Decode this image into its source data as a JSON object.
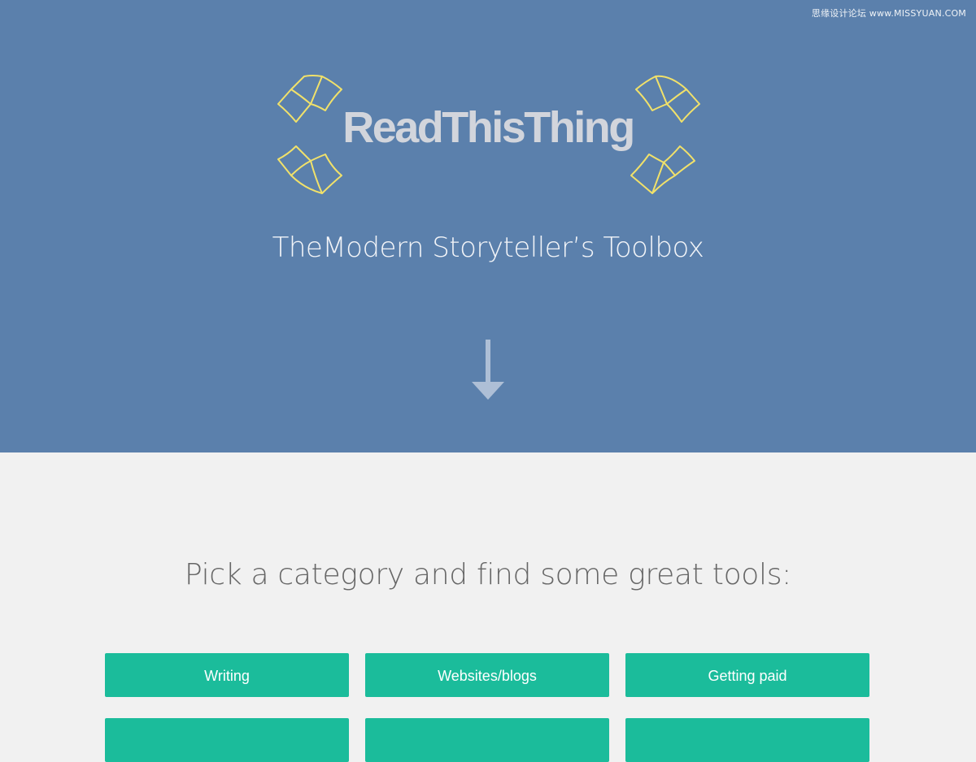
{
  "watermark": {
    "text": "思缘设计论坛 www.MISSYUAN.COM"
  },
  "hero": {
    "background_color": "#5b80ac",
    "logo_text": "ReadThisThing",
    "logo_icon": "open-book-icon",
    "logo_icon_color": "#f1e16a",
    "tagline": "TheModern Storyteller’s Toolbox",
    "scroll_icon": "arrow-down-icon"
  },
  "categories": {
    "heading": "Pick a category and find some great tools:",
    "button_color": "#1bbc9b",
    "buttons": [
      {
        "label": "Writing"
      },
      {
        "label": "Websites/blogs"
      },
      {
        "label": "Getting paid"
      },
      {
        "label": ""
      },
      {
        "label": ""
      },
      {
        "label": ""
      }
    ]
  }
}
